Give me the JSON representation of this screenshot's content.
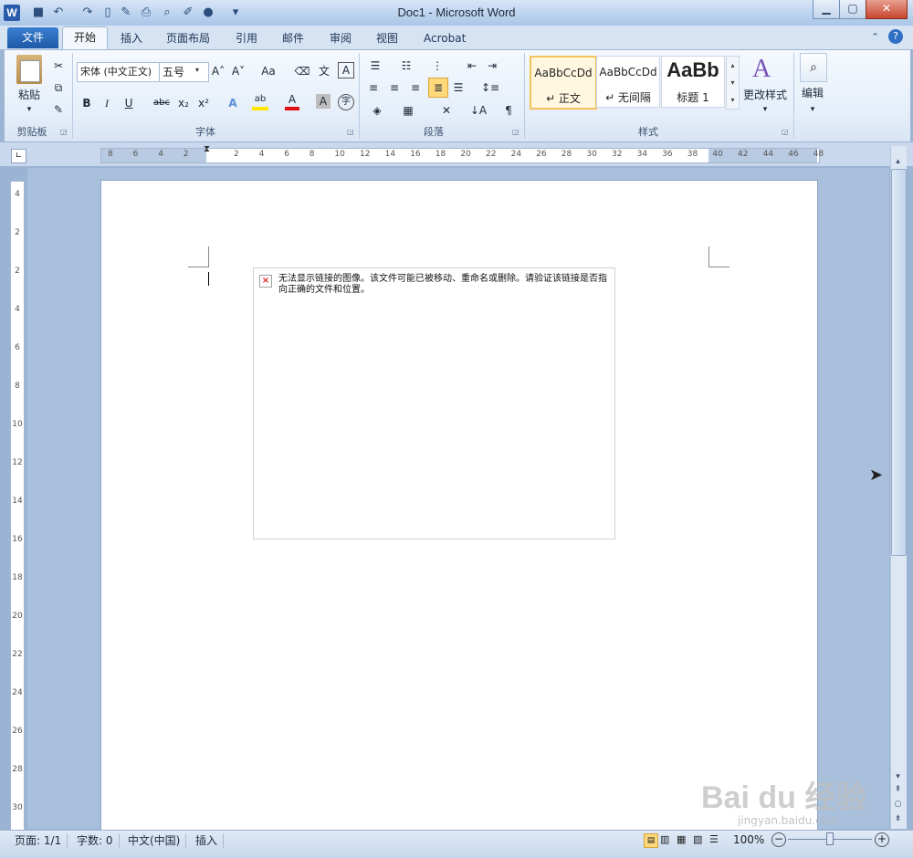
{
  "window": {
    "title": "Doc1  -  Microsoft Word",
    "minimize": "▁",
    "maximize": "▢",
    "close": "✕"
  },
  "qat": {
    "logo": "W",
    "icons": [
      "save-icon",
      "undo-icon",
      "redo-icon",
      "new-icon",
      "edit-icon",
      "print-icon",
      "preview-icon",
      "format-painter-icon",
      "circle-icon",
      "customize-icon"
    ]
  },
  "tabs": {
    "file": "文件",
    "items": [
      "开始",
      "插入",
      "页面布局",
      "引用",
      "邮件",
      "审阅",
      "视图",
      "Acrobat"
    ]
  },
  "ribbon": {
    "clipboard": {
      "paste": "粘贴",
      "label": "剪贴板"
    },
    "font": {
      "name": "宋体 (中文正文)",
      "size": "五号",
      "label": "字体",
      "grow": "A˄",
      "shrink": "A˅",
      "case": "Aa",
      "pinyin": "文",
      "border": "A",
      "bold": "B",
      "italic": "I",
      "underline": "U",
      "strike": "abc",
      "sub": "x₂",
      "sup": "x²",
      "effects": "A",
      "highlight": "ab",
      "color": "A",
      "shading": "A",
      "circle": "字"
    },
    "paragraph": {
      "label": "段落"
    },
    "styles": {
      "label": "样式",
      "items": [
        {
          "sample": "AaBbCcDd",
          "name": "↵ 正文"
        },
        {
          "sample": "AaBbCcDd",
          "name": "↵ 无间隔"
        },
        {
          "sample": "AaBb",
          "name": "标题 1"
        }
      ],
      "change": "更改样式"
    },
    "editing": {
      "label": "编辑"
    }
  },
  "ruler": {
    "h_ticks": [
      "8",
      "6",
      "4",
      "2",
      "2",
      "4",
      "6",
      "8",
      "10",
      "12",
      "14",
      "16",
      "18",
      "20",
      "22",
      "24",
      "26",
      "28",
      "30",
      "32",
      "34",
      "36",
      "38",
      "40",
      "42",
      "44",
      "46",
      "48"
    ],
    "v_ticks": [
      "4",
      "2",
      "2",
      "4",
      "6",
      "8",
      "10",
      "12",
      "14",
      "16",
      "18",
      "20",
      "22",
      "24",
      "26",
      "28",
      "30"
    ]
  },
  "document": {
    "broken_image_text": "无法显示链接的图像。该文件可能已被移动、重命名或删除。请验证该链接是否指向正确的文件和位置。",
    "broken_mark": "×"
  },
  "status": {
    "page": "页面: 1/1",
    "words": "字数: 0",
    "lang": "中文(中国)",
    "mode": "插入",
    "zoom": "100%"
  },
  "watermark": {
    "logo": "Bai du 经验",
    "url": "jingyan.baidu.com"
  },
  "colors": {
    "file_tab": "#2a6bc0",
    "ribbon": "#e5eef9",
    "workspace": "#a9c0dd"
  }
}
